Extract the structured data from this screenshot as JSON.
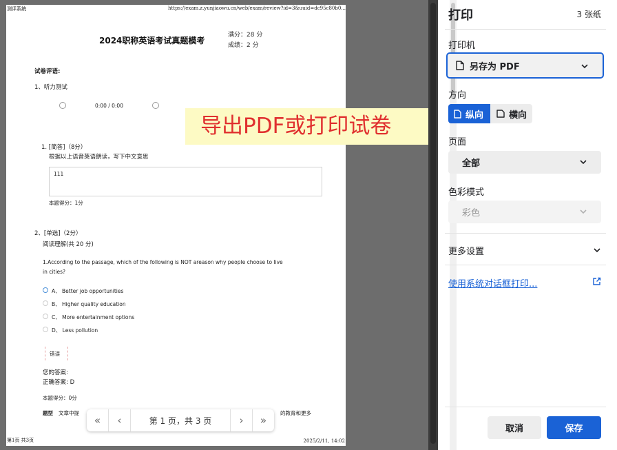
{
  "document": {
    "header_left": "测评系统",
    "header_right": "https://exam.z.yunjiaowu.cn/web/exam/review?id=3&uuid=dc95c80b0...",
    "footer_left": "第1页 共3页",
    "footer_right": "2025/2/11, 14:02",
    "title": "2024职称英语考试真题模考",
    "full_score": "满分：28 分",
    "score": "成绩：2 分",
    "review_heading": "试卷评语:",
    "section1": "1、听力测试",
    "audio_time": "0:00 / 0:00",
    "q1_head": "1. [简答]（8分）",
    "q1_prompt": "根据以上语音英语朗读，写下中文意思",
    "q1_answer": "111",
    "q1_score": "本题得分：1分",
    "q2_head": "2、[单选]（2分）",
    "q2_sub": "阅读理解(共 20 分)",
    "q2_line1": "1.According to the passage, which of the following is NOT areason why people choose to live",
    "q2_line2": "in cities?",
    "options": [
      "A、 Better job opportunities",
      "B、 Higher quality education",
      "C、 More entertainment options",
      "D、 Less pollution"
    ],
    "wrong_tag": "错误",
    "your_answer": "您的答案:",
    "correct_answer": "正确答案:  D",
    "q2_score": "本题得分：0分",
    "analysis_label": "题型",
    "analysis_text_start": "文章中提",
    "analysis_text_end": "的教育和更多"
  },
  "overlay_caption": "导出PDF或打印试卷",
  "pager": {
    "label": "第 1 页，共 3 页"
  },
  "dialog": {
    "title": "打印",
    "sheets": "3 张纸",
    "printer_label": "打印机",
    "printer_value": "另存为 PDF",
    "orientation_label": "方向",
    "portrait": "纵向",
    "landscape": "横向",
    "pages_label": "页面",
    "pages_value": "全部",
    "color_label": "色彩模式",
    "color_value": "彩色",
    "more_settings": "更多设置",
    "system_dialog_link": "使用系统对话框打印...",
    "cancel": "取消",
    "save": "保存"
  },
  "colors": {
    "accent": "#1a62d6",
    "caption_text": "#e0302f",
    "caption_bg": "#fdfac4"
  }
}
